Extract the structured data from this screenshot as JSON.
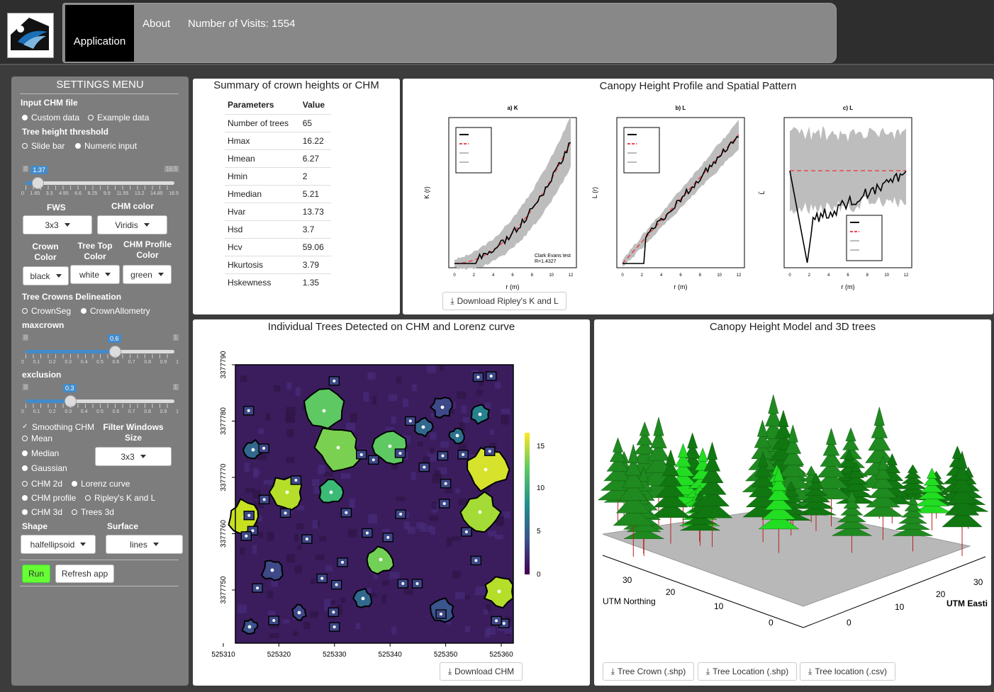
{
  "nav": {
    "app_tab": "Application",
    "about": "About",
    "visits": "Number of Visits: 1554"
  },
  "sidebar": {
    "title": "SETTINGS MENU",
    "input_chm_label": "Input CHM file",
    "input_opts": [
      "Custom data",
      "Example data"
    ],
    "threshold_label": "Tree height threshold",
    "threshold_opts": [
      "Slide bar",
      "Numeric input"
    ],
    "threshold_slider": {
      "min": "0",
      "max": "16.5",
      "value": "1.37",
      "value_fraction": 0.083,
      "ticks": [
        "0",
        "1.65",
        "3.3",
        "4.95",
        "6.6",
        "8.25",
        "9.9",
        "11.55",
        "13.2",
        "14.85",
        "16.5"
      ]
    },
    "fws_label": "FWS",
    "fws_value": "3x3",
    "chm_color_label": "CHM color",
    "chm_color_value": "Viridis",
    "crown_color_label": "Crown Color",
    "crown_color_value": "black",
    "treetop_color_label": "Tree Top Color",
    "treetop_color_value": "white",
    "profile_color_label": "CHM Profile Color",
    "profile_color_value": "green",
    "delineation_label": "Tree Crowns Delineation",
    "delineation_opts": [
      "CrownSeg",
      "CrownAllometry"
    ],
    "maxcrown_label": "maxcrown",
    "maxcrown_slider": {
      "min": "0",
      "max": "1",
      "value": "0.6",
      "value_fraction": 0.6,
      "ticks": [
        "0",
        "0.1",
        "0.2",
        "0.3",
        "0.4",
        "0.5",
        "0.6",
        "0.7",
        "0.8",
        "0.9",
        "1"
      ]
    },
    "exclusion_label": "exclusion",
    "exclusion_slider": {
      "min": "0",
      "max": "1",
      "value": "0.3",
      "value_fraction": 0.3,
      "ticks": [
        "0",
        "0.1",
        "0.2",
        "0.3",
        "0.4",
        "0.5",
        "0.6",
        "0.7",
        "0.8",
        "0.9",
        "1"
      ]
    },
    "smoothing_label": "Smoothing CHM",
    "filter_label": "Filter Windows Size",
    "filter_value": "3x3",
    "smooth_opts": [
      "Mean",
      "Median",
      "Gaussian"
    ],
    "plot_opts": [
      "CHM 2d",
      "Lorenz curve",
      "CHM profile",
      "Ripley's K and L",
      "CHM 3d",
      "Trees 3d"
    ],
    "shape_label": "Shape",
    "shape_value": "halfellipsoid",
    "surface_label": "Surface",
    "surface_value": "lines",
    "run_label": "Run",
    "refresh_label": "Refresh app",
    "accent": "#428bca",
    "run_color": "#66ff33"
  },
  "summary": {
    "title": "Summary of crown heights or CHM",
    "headers": [
      "Parameters",
      "Value"
    ],
    "rows": [
      [
        "Number of trees",
        "65"
      ],
      [
        "Hmax",
        "16.22"
      ],
      [
        "Hmean",
        "6.27"
      ],
      [
        "Hmin",
        "2"
      ],
      [
        "Hmedian",
        "5.21"
      ],
      [
        "Hvar",
        "13.73"
      ],
      [
        "Hsd",
        "3.7"
      ],
      [
        "Hcv",
        "59.06"
      ],
      [
        "Hkurtosis",
        "3.79"
      ],
      [
        "Hskewness",
        "1.35"
      ]
    ]
  },
  "ripley": {
    "title": "Canopy Height Profile and Spatial Pattern",
    "plots": [
      "a) K",
      "b) L",
      "c) L"
    ],
    "xlabel": "r (m)",
    "ylabels": [
      "K (r)",
      "L (r)",
      "L̂"
    ],
    "annotation": "Clark Evans test\nR=1.4327",
    "download_label": "Download Ripley's K and L"
  },
  "chm2d": {
    "title": "Individual Trees Detected on CHM and Lorenz curve",
    "x_ticks": [
      "525310",
      "525320",
      "525330",
      "525340",
      "525350",
      "525360"
    ],
    "y_ticks": [
      "3377750",
      "3377760",
      "3377770",
      "3377780",
      "3377790"
    ],
    "legend_ticks": [
      "15",
      "10",
      "5",
      "0"
    ],
    "download_label": "Download CHM"
  },
  "chm3d": {
    "title": "Canopy Height Model and 3D trees",
    "axis_north": "UTM Northing",
    "axis_east": "UTM Easti",
    "north_ticks": [
      "30",
      "20",
      "10",
      "0"
    ],
    "east_ticks": [
      "0",
      "10",
      "20",
      "30"
    ],
    "buttons": [
      "Tree Crown (.shp)",
      "Tree Location (.shp)",
      "Tree location (.csv)"
    ]
  }
}
